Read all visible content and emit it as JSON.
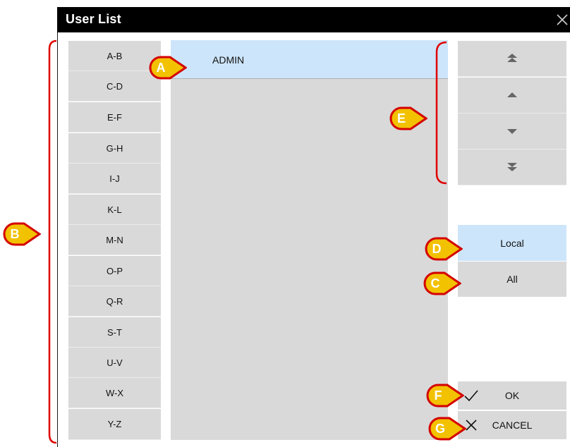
{
  "window": {
    "title": "User List"
  },
  "alphabet": [
    "A-B",
    "C-D",
    "E-F",
    "G-H",
    "I-J",
    "K-L",
    "M-N",
    "O-P",
    "Q-R",
    "S-T",
    "U-V",
    "W-X",
    "Y-Z"
  ],
  "users": [
    {
      "name": "ADMIN",
      "selected": true
    }
  ],
  "navigation": [
    "first-page-icon",
    "page-up-icon",
    "page-down-icon",
    "last-page-icon"
  ],
  "filters": {
    "local": "Local",
    "all": "All",
    "selected": "local"
  },
  "actions": {
    "ok": "OK",
    "cancel": "CANCEL"
  },
  "callouts": {
    "A": "A",
    "B": "B",
    "C": "C",
    "D": "D",
    "E": "E",
    "F": "F",
    "G": "G"
  },
  "colors": {
    "titlebar": "#000000",
    "button": "#d9d9d9",
    "selected": "#cde5fa",
    "bracket": "#e00000",
    "callout": "#e8a800"
  }
}
